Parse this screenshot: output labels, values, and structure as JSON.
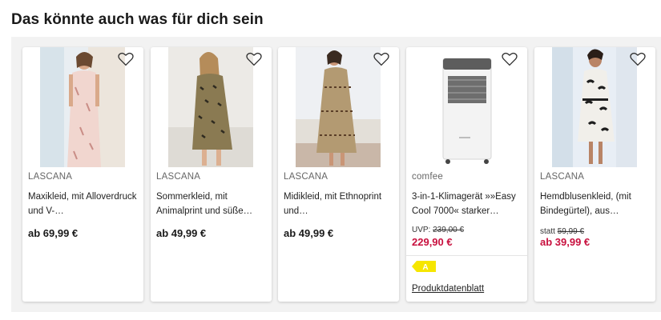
{
  "section_title": "Das könnte auch was für dich sein",
  "products": [
    {
      "brand": "LASCANA",
      "name": "Maxikleid, mit Alloverdruck und V-…",
      "price": "ab 69,99 €",
      "image": "woman-in-pink-maxi-dress-photo"
    },
    {
      "brand": "LASCANA",
      "name": "Sommerkleid, mit Animalprint und süße…",
      "price": "ab 49,99 €",
      "image": "woman-in-animal-print-dress-photo"
    },
    {
      "brand": "LASCANA",
      "name": "Midikleid, mit Ethnoprint und…",
      "price": "ab 49,99 €",
      "image": "woman-in-ethno-print-dress-photo"
    },
    {
      "brand": "comfee",
      "name": "3-in-1-Klimagerät »»Easy Cool 7000« starker…",
      "uvp_label": "UVP:",
      "old_price": "239,00 €",
      "sale_price": "229,90 €",
      "energy_class": "A",
      "datasheet_link": "Produktdatenblatt",
      "image": "portable-air-conditioner-photo"
    },
    {
      "brand": "LASCANA",
      "name": "Hemdblusenkleid, (mit Bindegürtel), aus…",
      "statt_label": "statt",
      "old_price": "59,99 €",
      "sale_price": "ab 39,99 €",
      "image": "woman-in-floral-shirt-dress-photo"
    }
  ],
  "colors": {
    "sale_red": "#c8103e",
    "energy_badge": "#f6e600",
    "section_bg": "#f2f2f2"
  }
}
